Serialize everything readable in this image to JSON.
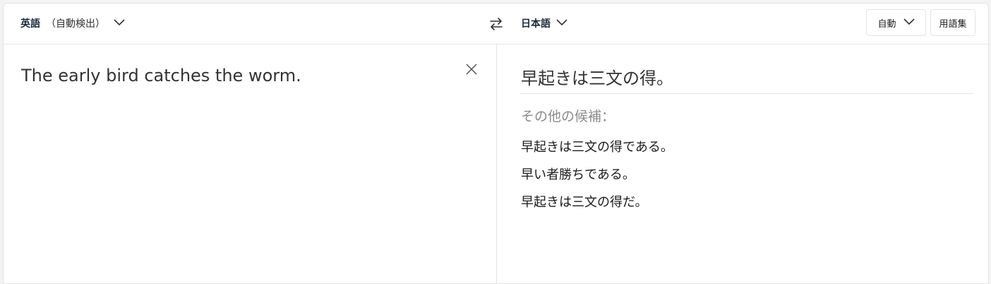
{
  "source_language": {
    "name": "英語",
    "detect_label": "（自動検出）"
  },
  "target_language": {
    "name": "日本語"
  },
  "toolbar": {
    "auto_label": "自動",
    "glossary_label": "用語集"
  },
  "icons": {
    "source_dropdown": "chevron-down-icon",
    "swap": "swap-icon",
    "target_dropdown": "chevron-down-icon",
    "clear": "close-icon"
  },
  "source": {
    "text": "The early bird catches the worm."
  },
  "result": {
    "translation": "早起きは三文の得。",
    "alternatives_label": "その他の候補：",
    "alternatives": [
      "早起きは三文の得である。",
      "早い者勝ちである。",
      "早起きは三文の得だ。"
    ]
  }
}
